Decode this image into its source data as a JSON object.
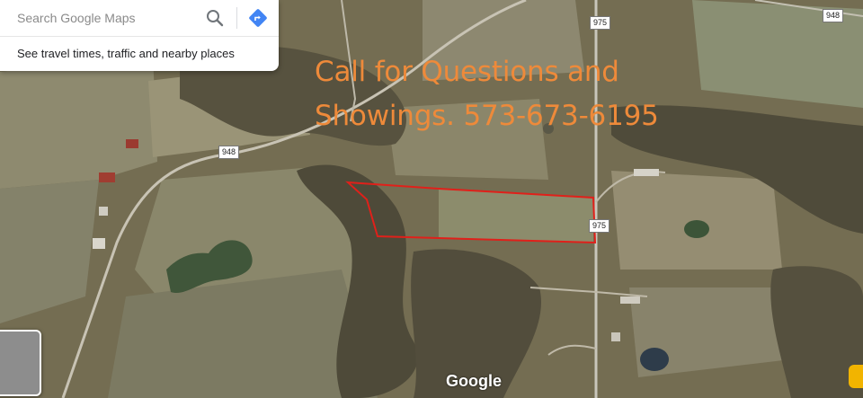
{
  "search": {
    "placeholder": "Search Google Maps",
    "search_icon": "search-icon",
    "directions_icon": "directions-icon",
    "hint": "See travel times, traffic and nearby places"
  },
  "overlay": {
    "line1": "Call for Questions and",
    "line2": "Showings. 573-673-6195",
    "color": "#ee8a3a"
  },
  "road_labels": {
    "r948_top": "948",
    "r948_left": "948",
    "r975_top": "975",
    "r975_mid": "975"
  },
  "map": {
    "attribution": "Google",
    "parcel_outline_color": "#e0201a",
    "map_type": "satellite"
  },
  "controls": {
    "layer_toggle_icon": "layers-thumbnail-icon",
    "pegman_icon": "street-view-pegman-icon"
  }
}
